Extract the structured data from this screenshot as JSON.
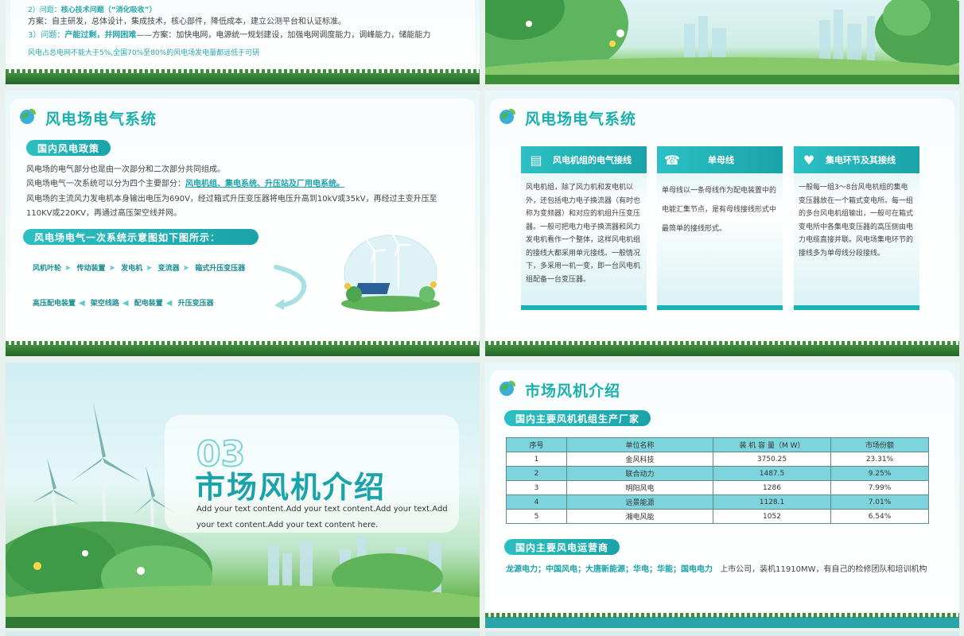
{
  "slide1": {
    "line1_prefix": "2）问题：",
    "line1_bold": "核心技术问题（“消化吸收”）",
    "line2": "方案：自主研发，总体设计，集成技术，核心部件，降低成本，建立公测平台和认证标准。",
    "line3_prefix": "3）问题：",
    "line3_bold": "产能过剩，并网困难",
    "line3_rest": "——方案：加快电网，电源统一规划建设，加强电网调度能力，调峰能力，储能能力",
    "note": "风电占总电网不能大于5%,全国70%至80%的风电场发电量都远低于可研"
  },
  "slide3": {
    "title": "风电场电气系统",
    "pill1": "国内风电政策",
    "p1": "风电场的电气部分也是由一次部分和二次部分共同组成。",
    "p2_prefix": "风电场电气一次系统可以分为四个主要部分：",
    "p2_highlight": "风电机组、集电系统、升压站及厂用电系统。",
    "p3": "风电场的主流风力发电机本身输出电压为690V，经过箱式升压变压器将电压升高到10kV或35kV，再经过主变升压至",
    "p4": "110KV或220KV，再通过高压架空线并网。",
    "pill2": "风电场电气一次系统示意图如下图所示：",
    "flow_row1": [
      "风机叶轮",
      "传动装置",
      "发电机",
      "变流器",
      "箱式升压变压器"
    ],
    "flow_row2": [
      "高压配电装置",
      "架空线路",
      "配电装置",
      "升压变压器"
    ]
  },
  "slide4": {
    "title": "风电场电气系统",
    "columns": [
      {
        "head": "风电机组的电气接线",
        "icon": "notebook-icon",
        "text": "风电机组，除了风力机和发电机以外，还包括电力电子换流器（有时也称为变频器）和对应的机组升压变压器。一般可把电力电子换流器和风力发电机看作一个整体，这样风电机组的接线大都采用单元接线。一般情况下，多采用一机一变，即一台风电机组配备一台变压器。"
      },
      {
        "head": "单母线",
        "icon": "telephone-icon",
        "text": "单母线以一条母线作为配电装置中的电能汇集节点，是有母线接线形式中最简单的接线形式。"
      },
      {
        "head": "集电环节及其接线",
        "icon": "heart-icon",
        "text": "一般每一组3～8台风电机组的集电变压器放在一个箱式变电所。每一组的多台风电机组输出，一般可在箱式变电所中各集电变压器的高压侧由电力电缆直接并联。风电场集电环节的接线多为单母线分段接线。"
      }
    ]
  },
  "slide5": {
    "number": "03",
    "title": "市场风机介绍",
    "sub1": "Add your text content.Add your text content.Add your text.Add",
    "sub2": "your text content.Add your text content here."
  },
  "slide6": {
    "title": "市场风机介绍",
    "pill1": "国内主要风机机组生产厂家",
    "table": {
      "headers": [
        "序号",
        "单位名称",
        "装 机 容 量（M W）",
        "市场份额"
      ],
      "rows": [
        [
          "1",
          "金风科技",
          "3750.25",
          "23.31%"
        ],
        [
          "2",
          "联合动力",
          "1487.5",
          "9.25%"
        ],
        [
          "3",
          "明阳风电",
          "1286",
          "7.99%"
        ],
        [
          "4",
          "远景能源",
          "1128.1",
          "7.01%"
        ],
        [
          "5",
          "湘电风能",
          "1052",
          "6.54%"
        ]
      ]
    },
    "pill2": "国内主要风电运营商",
    "operators": "龙源电力；中国风电；大唐新能源；华电；华能；国电电力",
    "operators_rest": "上市公司，装机11910MW，有自己的检修团队和培训机构"
  },
  "colors": {
    "accent": "#1aa3a8",
    "teal_light": "#7ed4dc",
    "grass": "#3e8f3a"
  }
}
